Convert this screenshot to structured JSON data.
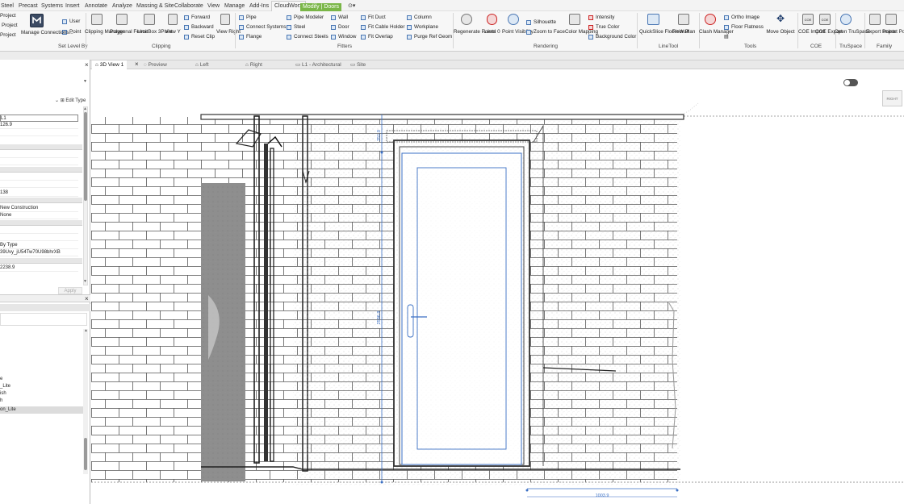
{
  "menubar": {
    "items": [
      "Steel",
      "Precast",
      "Systems",
      "Insert",
      "Annotate",
      "Analyze",
      "Massing & Site",
      "Collaborate",
      "View",
      "Manage",
      "Add-Ins",
      "CloudWorx",
      "Modify | Doors"
    ],
    "active": "CloudWorx",
    "context_tab": "Modify | Doors",
    "extra_icon": "dropdown-icon"
  },
  "ribbon": {
    "project_a": "Project",
    "project_b": "Project",
    "project_c": "Project",
    "user": "User",
    "point": "Point",
    "manage_connections": "Manage Connections...",
    "set_level_by": "Set Level By",
    "clipping_manager": "Clipping Manager",
    "polygonal_fence": "Polygonal Fence",
    "limitbox_3point": "LimitBox 3Point",
    "view_y": "View Y",
    "view_right": "View Right",
    "forward": "Forward",
    "backward": "Backward",
    "reset_clip": "Reset Clip",
    "clipping": "Clipping",
    "pipe": "Pipe",
    "connect_systems": "Connect Systems",
    "flange": "Flange",
    "pipe_modeler": "Pipe Modeler",
    "steel": "Steel",
    "connect_steels": "Connect Steels",
    "wall": "Wall",
    "door": "Door",
    "window": "Window",
    "fit_duct": "Fit Duct",
    "fit_cable_holder": "Fit Cable Holder",
    "fit_overlap": "Fit Overlap",
    "column": "Column",
    "workplane": "Workplane",
    "purge_ref_geom": "Purge Ref Geom",
    "fitters": "Fitters",
    "regenerate_points": "Regenerate Points",
    "level_0": "Level 0",
    "point_visibility": "Point Visibility",
    "silhouette": "Silhouette",
    "zoom_to_face": "Zoom to Face",
    "color_mapping": "Color Mapping",
    "intensity": "Intensity",
    "true_color": "True Color",
    "background_color": "Background Color",
    "rendering": "Rendering",
    "quickslice": "QuickSlice Floor+Wall",
    "floor_plan": "Floor Plan",
    "linetool": "LineTool",
    "clash_manager": "Clash Manager",
    "ortho_image": "Ortho Image",
    "floor_flatness": "Floor Flatness",
    "move_object": "Move Object",
    "tools": "Tools",
    "coe_import": "COE Import",
    "coe_export": "COE Export",
    "coe": "COE",
    "open_truspace": "Open TruSpace",
    "truspace": "TruSpace",
    "export_points": "Export Points",
    "import_points": "Import Points",
    "family": "Family",
    "coe_icon_text": "COE"
  },
  "left_panel": {
    "edit_type": "Edit Type",
    "rows": [
      "L1",
      "126.9",
      "",
      "",
      "",
      "",
      "",
      "138",
      "",
      "New Construction",
      "None",
      "",
      "",
      "By Type",
      "39Uvy_jU54Tw70U98bhrXB",
      "",
      "2238.9"
    ],
    "apply": "Apply",
    "browser_items": [
      "e",
      "_Lite",
      "ish",
      "h",
      "on_Lite"
    ]
  },
  "tabs": [
    "3D View 1",
    "Preview",
    "Left",
    "Right",
    "L1 - Architectural",
    "Site"
  ],
  "viewport": {
    "dim_top": "251.0",
    "dim_mid": "2596.9",
    "dim_bottom": "1003.9",
    "viewcube": "RIGHT"
  },
  "colors": {
    "context_tab": "#7ab648",
    "dimension": "#3a6fc4",
    "door_blue": "#3a6fc4",
    "ribbon_bg": "#f7f7f7"
  }
}
